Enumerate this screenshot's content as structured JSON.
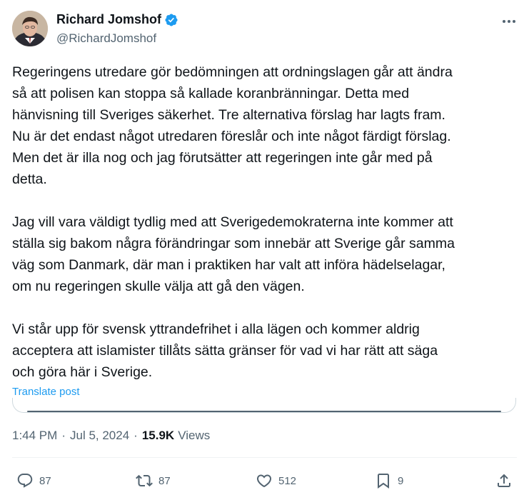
{
  "author": {
    "name": "Richard Jomshof",
    "handle": "@RichardJomshof",
    "verified": true
  },
  "post": {
    "paragraphs": [
      "Regeringens utredare gör bedömningen att ordningslagen går att ändra\nså att polisen kan stoppa så kallade koranbränningar. Detta med\nhänvisning till Sveriges säkerhet. Tre alternativa förslag har lagts fram.\nNu är det endast något utredaren föreslår och inte något färdigt förslag.\nMen det är illa nog och jag förutsätter att regeringen inte går med på\ndetta.",
      "Jag vill vara väldigt tydlig med att Sverigedemokraterna inte kommer att\nställa sig bakom några förändringar som innebär att Sverige går samma\nväg som Danmark, där man i praktiken har valt att införa hädelselagar,\nom nu regeringen skulle välja att gå den vägen.",
      "Vi står upp för svensk yttrandefrihet i alla lägen och kommer aldrig\nacceptera att islamister tillåts sätta gränser för vad vi har rätt att säga\noch göra här i Sverige."
    ],
    "translate_label": "Translate post"
  },
  "meta": {
    "time": "1:44 PM",
    "separator": "·",
    "date": "Jul 5, 2024",
    "views_count": "15.9K",
    "views_label": "Views"
  },
  "actions": {
    "replies": "87",
    "reposts": "87",
    "likes": "512",
    "bookmarks": "9"
  },
  "colors": {
    "text": "#0f1419",
    "secondary": "#536471",
    "accent": "#1d9bf0"
  },
  "icons": [
    "verified-badge-icon",
    "more-icon",
    "reply-icon",
    "repost-icon",
    "like-icon",
    "bookmark-icon",
    "share-icon"
  ]
}
